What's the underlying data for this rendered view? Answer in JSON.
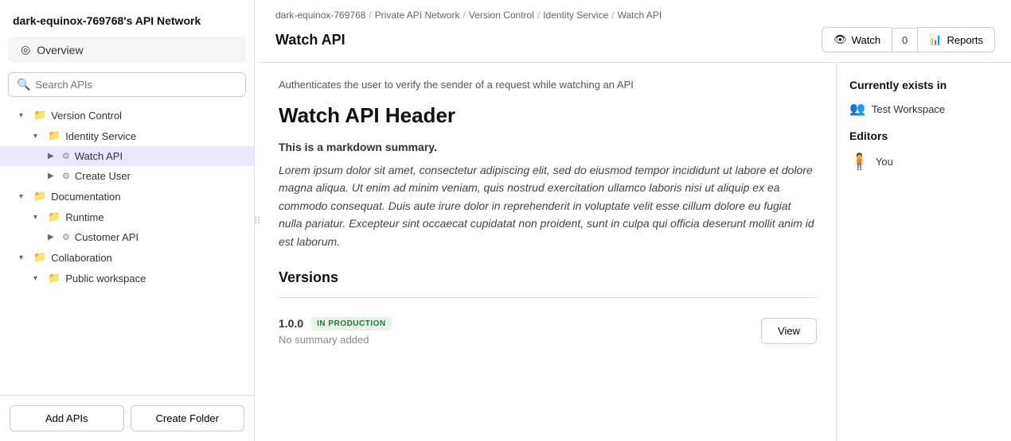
{
  "sidebar": {
    "title": "dark-equinox-769768's API Network",
    "overview_label": "Overview",
    "search_placeholder": "Search APIs",
    "tree": [
      {
        "id": "version-control",
        "label": "Version Control",
        "indent": 1,
        "type": "folder",
        "chevron": "▾",
        "selected": false
      },
      {
        "id": "identity-service",
        "label": "Identity Service",
        "indent": 2,
        "type": "folder",
        "chevron": "▾",
        "selected": false
      },
      {
        "id": "watch-api",
        "label": "Watch API",
        "indent": 3,
        "type": "api",
        "chevron": "▶",
        "selected": true
      },
      {
        "id": "create-user",
        "label": "Create User",
        "indent": 3,
        "type": "api",
        "chevron": "▶",
        "selected": false
      },
      {
        "id": "documentation",
        "label": "Documentation",
        "indent": 1,
        "type": "folder",
        "chevron": "▾",
        "selected": false
      },
      {
        "id": "runtime",
        "label": "Runtime",
        "indent": 2,
        "type": "folder",
        "chevron": "▾",
        "selected": false
      },
      {
        "id": "customer-api",
        "label": "Customer API",
        "indent": 3,
        "type": "api",
        "chevron": "▶",
        "selected": false
      },
      {
        "id": "collaboration",
        "label": "Collaboration",
        "indent": 1,
        "type": "folder",
        "chevron": "▾",
        "selected": false
      },
      {
        "id": "public-workspace",
        "label": "Public workspace",
        "indent": 2,
        "type": "folder",
        "chevron": "▾",
        "selected": false
      }
    ],
    "add_apis_label": "Add APIs",
    "create_folder_label": "Create Folder"
  },
  "breadcrumb": {
    "items": [
      "dark-equinox-769768",
      "Private API Network",
      "Version Control",
      "Identity Service",
      "Watch API"
    ]
  },
  "page": {
    "title": "Watch API",
    "description": "Authenticates the user to verify the sender of a request while watching an API",
    "header": "Watch API Header",
    "markdown_summary": "This is a markdown summary.",
    "markdown_body": "Lorem ipsum dolor sit amet, consectetur adipiscing elit, sed do eiusmod tempor incididunt ut labore et dolore magna aliqua. Ut enim ad minim veniam, quis nostrud exercitation ullamco laboris nisi ut aliquip ex ea commodo consequat. Duis aute irure dolor in reprehenderit in voluptate velit esse cillum dolore eu fugiat nulla pariatur. Excepteur sint occaecat cupidatat non proident, sunt in culpa qui officia deserunt mollit anim id est laborum.",
    "versions_title": "Versions",
    "watch_label": "Watch",
    "watch_count": "0",
    "reports_label": "Reports"
  },
  "versions": [
    {
      "number": "1.0.0",
      "status": "IN PRODUCTION",
      "summary": "No summary added",
      "view_label": "View"
    }
  ],
  "right_sidebar": {
    "currently_exists_title": "Currently exists in",
    "workspace": "Test Workspace",
    "editors_title": "Editors",
    "editor_name": "You",
    "avatar": "🧍"
  },
  "icons": {
    "overview": "◎",
    "search": "🔍",
    "folder_open": "📂",
    "folder_closed": "📁",
    "api": "⚙",
    "eye": "👁",
    "chart": "📊",
    "users": "👥",
    "resize": "⠿"
  }
}
